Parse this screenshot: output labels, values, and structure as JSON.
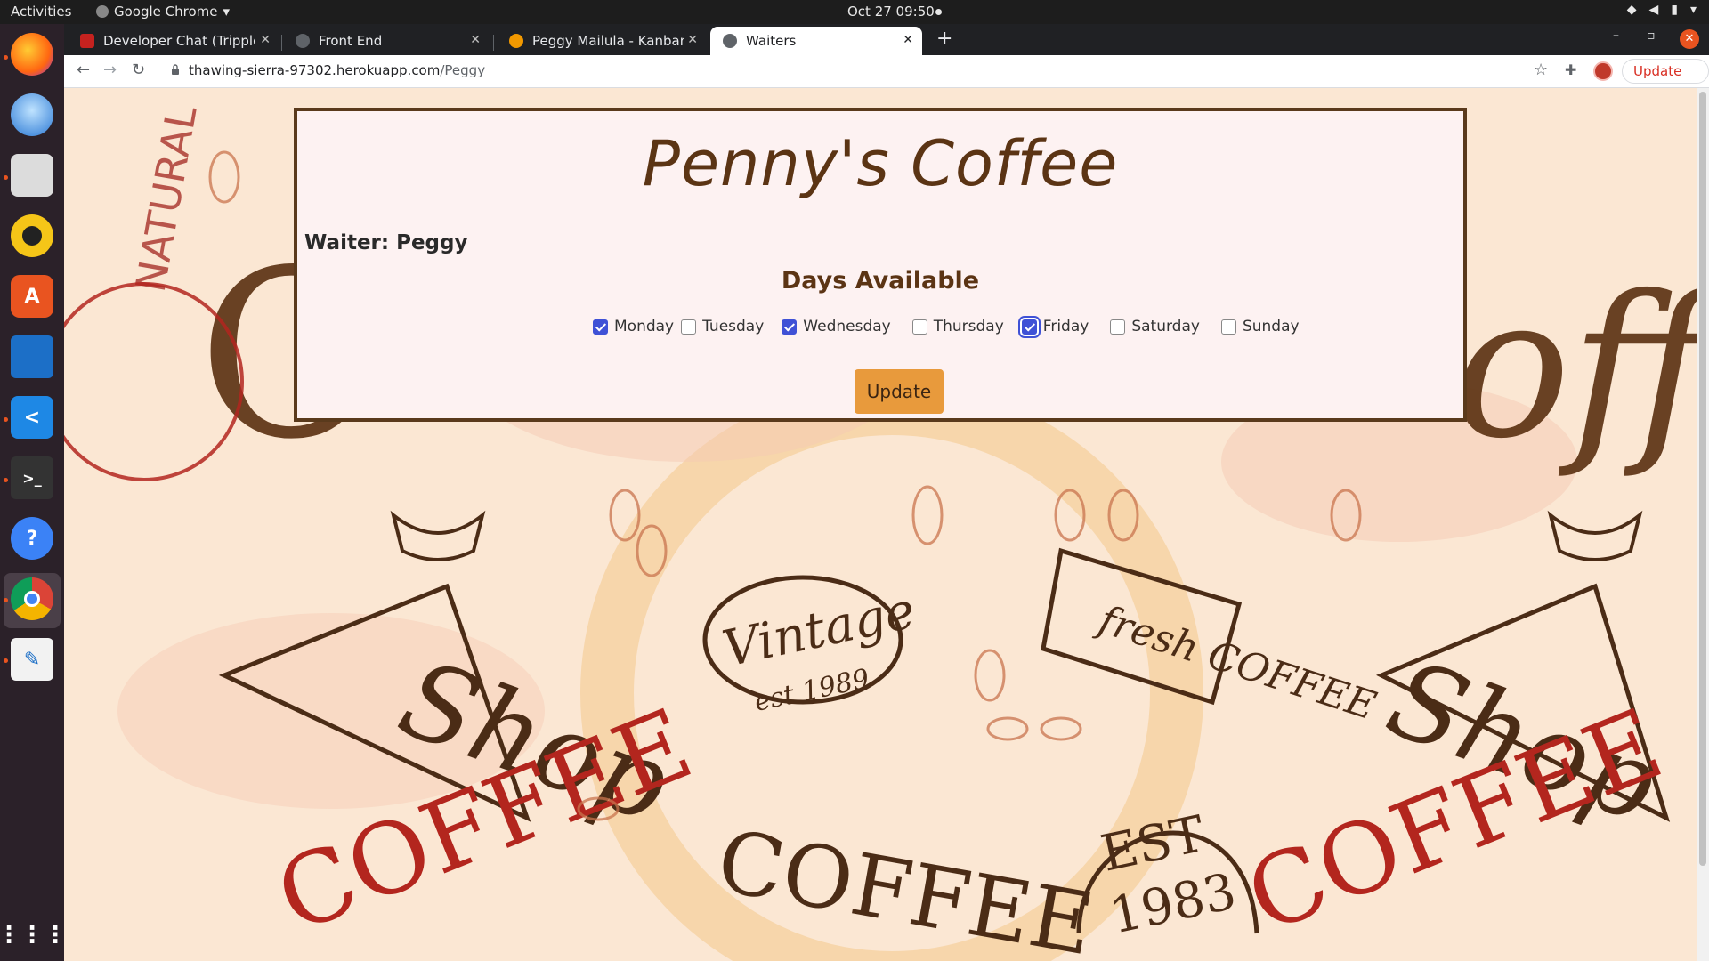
{
  "topbar": {
    "activities": "Activities",
    "app_name": "Google Chrome",
    "clock": "Oct 27  09:50"
  },
  "dock": {
    "apps": [
      "firefox-icon",
      "thunderbird-icon",
      "files-icon",
      "rhythmbox-icon",
      "software-icon",
      "writer-icon",
      "vscode-icon",
      "terminal-icon",
      "help-icon",
      "chrome-icon",
      "text-editor-icon",
      "show-apps-icon"
    ]
  },
  "tabs": [
    {
      "title": "Developer Chat (Tripplo)",
      "favicon_color": "#c5221f"
    },
    {
      "title": "Front End",
      "favicon_color": "#5f6368"
    },
    {
      "title": "Peggy Mailula - KanbanFl",
      "favicon_color": "#f29900"
    },
    {
      "title": "Waiters",
      "favicon_color": "#5f6368"
    }
  ],
  "toolbar": {
    "url_host": "thawing-sierra-97302.herokuapp.com",
    "url_path": "/Peggy",
    "update_label": "Update"
  },
  "page": {
    "brand": "Penny's Coffee",
    "waiter_label": "Waiter: Peggy",
    "days_title": "Days Available",
    "days": [
      {
        "label": "Monday",
        "checked": true
      },
      {
        "label": "Tuesday",
        "checked": false
      },
      {
        "label": "Wednesday",
        "checked": true
      },
      {
        "label": "Thursday",
        "checked": false
      },
      {
        "label": "Friday",
        "checked": true
      },
      {
        "label": "Saturday",
        "checked": false
      },
      {
        "label": "Sunday",
        "checked": false
      }
    ],
    "update_button": "Update",
    "accent_color": "#e89a3c",
    "brand_color": "#5b3414"
  }
}
